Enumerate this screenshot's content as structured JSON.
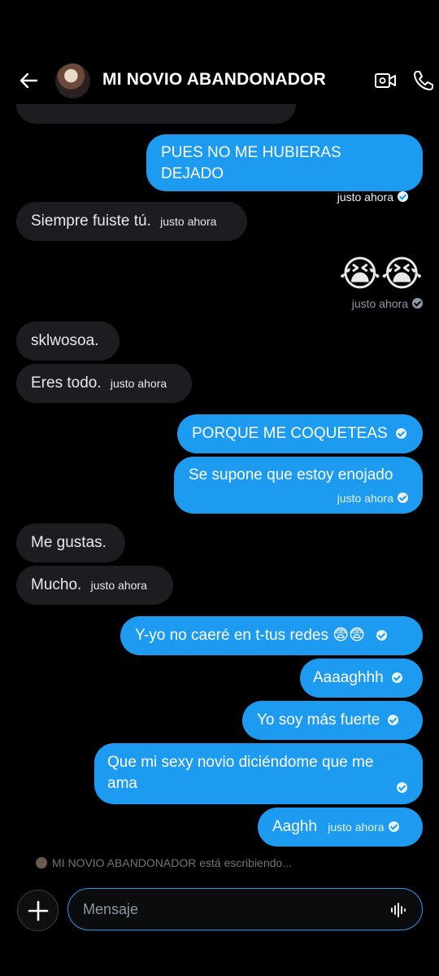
{
  "header": {
    "contact_name": "MI NOVIO ABANDONADOR"
  },
  "icons": {
    "back": "arrow-left-icon",
    "video": "video-camera-icon",
    "phone": "phone-icon",
    "plus": "plus-icon",
    "voice": "waveform-icon",
    "check": "checkmark-circle-icon"
  },
  "colors": {
    "accent": "#1d9bf0",
    "incoming_bubble": "#1c1d20",
    "background": "#000000"
  },
  "messages": [
    {
      "dir": "out",
      "text": "PUES NO ME HUBIERAS DEJADO",
      "time": "justo ahora"
    },
    {
      "dir": "in",
      "text": "Siempre fuiste tú.",
      "time": "justo ahora"
    },
    {
      "dir": "out",
      "text": "😭😭",
      "time": "justo ahora"
    },
    {
      "dir": "in",
      "text": "sklwosoa."
    },
    {
      "dir": "in",
      "text": "Eres todo.",
      "time": "justo ahora"
    },
    {
      "dir": "out",
      "text": "PORQUE ME COQUETEAS"
    },
    {
      "dir": "out",
      "text": "Se supone que estoy enojado",
      "time": "justo ahora"
    },
    {
      "dir": "in",
      "text": "Me gustas."
    },
    {
      "dir": "in",
      "text": "Mucho.",
      "time": "justo ahora"
    },
    {
      "dir": "out",
      "text": "Y-yo no caeré en t-tus redes 😨😨"
    },
    {
      "dir": "out",
      "text": "Aaaaghhh"
    },
    {
      "dir": "out",
      "text": "Yo soy más fuerte"
    },
    {
      "dir": "out",
      "text": "Que mi sexy novio diciéndome que me ama"
    },
    {
      "dir": "out",
      "text": "Aaghh",
      "time": "justo ahora"
    }
  ],
  "typing_indicator": "MI NOVIO ABANDONADOR está escribiendo...",
  "composer": {
    "placeholder": "Mensaje"
  }
}
